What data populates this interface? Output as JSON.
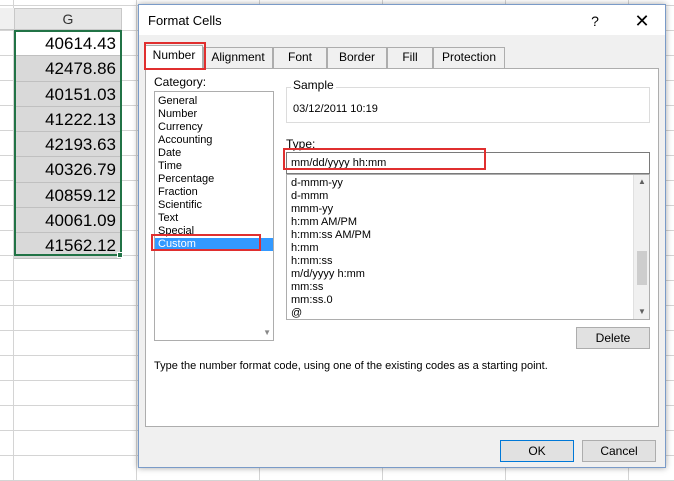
{
  "sheet": {
    "column_header": "G",
    "cells": [
      "40614.43",
      "42478.86",
      "40151.03",
      "41222.13",
      "42193.63",
      "40326.79",
      "40859.12",
      "40061.09",
      "41562.12"
    ]
  },
  "dialog": {
    "title": "Format Cells",
    "help_glyph": "?",
    "close_glyph": "✕",
    "tabs": [
      "Number",
      "Alignment",
      "Font",
      "Border",
      "Fill",
      "Protection"
    ],
    "active_tab": "Number",
    "category_label": "Category:",
    "categories": [
      "General",
      "Number",
      "Currency",
      "Accounting",
      "Date",
      "Time",
      "Percentage",
      "Fraction",
      "Scientific",
      "Text",
      "Special",
      "Custom"
    ],
    "selected_category": "Custom",
    "sample_label": "Sample",
    "sample_value": "03/12/2011 10:19",
    "type_label": "Type:",
    "type_value": "mm/dd/yyyy hh:mm",
    "formats": [
      "d-mmm-yy",
      "d-mmm",
      "mmm-yy",
      "h:mm AM/PM",
      "h:mm:ss AM/PM",
      "h:mm",
      "h:mm:ss",
      "m/d/yyyy h:mm",
      "mm:ss",
      "mm:ss.0",
      "@"
    ],
    "delete_label": "Delete",
    "description": "Type the number format code, using one of the existing codes as a starting point.",
    "ok_label": "OK",
    "cancel_label": "Cancel"
  },
  "colors": {
    "highlight": "#e02f2f",
    "selection": "#3399ff",
    "excel_green": "#217346"
  },
  "icons": {
    "scroll_up": "▲",
    "scroll_down": "▼"
  }
}
